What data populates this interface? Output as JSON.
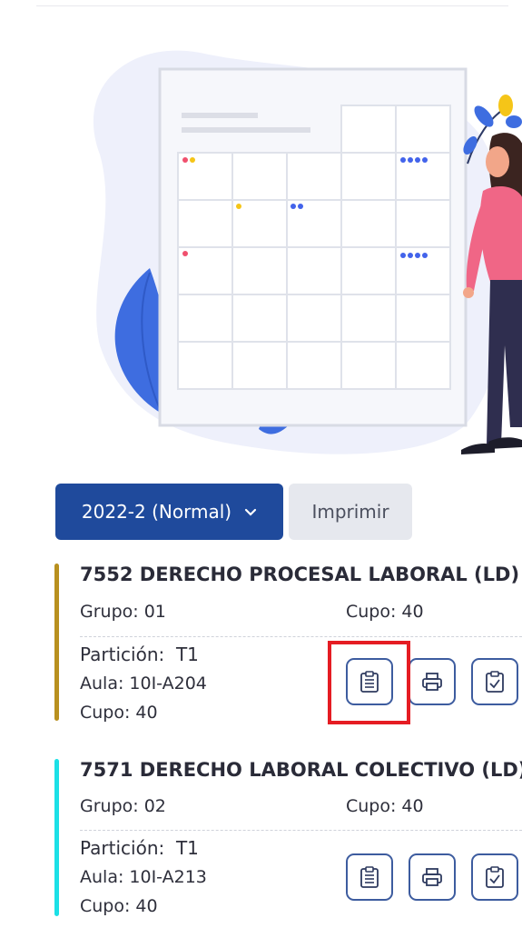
{
  "controls": {
    "period_label": "2022-2 (Normal)",
    "print_label": "Imprimir"
  },
  "colors": {
    "primary": "#1f4a9c",
    "course1_accent": "#b8901f",
    "course2_accent": "#1be0e6",
    "highlight": "#e51c23"
  },
  "courses": [
    {
      "title": "7552 DERECHO PROCESAL LABORAL (LD)",
      "group": "Grupo: 01",
      "cupo": "Cupo: 40",
      "partition_label": "Partición:",
      "partition_value": "T1",
      "aula": "Aula: 10I-A204",
      "partition_cupo": "Cupo: 40",
      "icons": [
        "clipboard-list-icon",
        "printer-icon",
        "clipboard-check-icon"
      ]
    },
    {
      "title": "7571 DERECHO LABORAL COLECTIVO (LD)",
      "group": "Grupo: 02",
      "cupo": "Cupo: 40",
      "partition_label": "Partición:",
      "partition_value": "T1",
      "aula": "Aula: 10I-A213",
      "partition_cupo": "Cupo: 40",
      "icons": [
        "clipboard-list-icon",
        "printer-icon",
        "clipboard-check-icon"
      ]
    }
  ]
}
